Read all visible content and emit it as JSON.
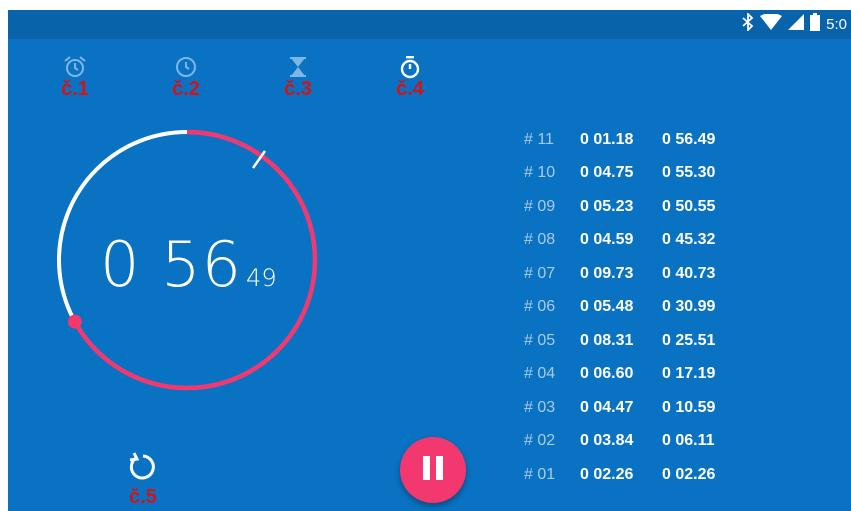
{
  "status_bar": {
    "time": "5:0",
    "icons": [
      "bluetooth-icon",
      "wifi-icon",
      "signal-icon",
      "battery-icon"
    ]
  },
  "tabs": [
    {
      "id": "alarm",
      "icon": "alarm-icon",
      "number": "č.1"
    },
    {
      "id": "clock",
      "icon": "clock-icon",
      "number": "č.2"
    },
    {
      "id": "timer",
      "icon": "hourglass-icon",
      "number": "č.3"
    },
    {
      "id": "stopwatch",
      "icon": "stopwatch-icon",
      "number": "č.4"
    }
  ],
  "stopwatch": {
    "seconds_display": "0 56",
    "hundredths_display": "49",
    "lap_progress_fraction": 0.67
  },
  "laps": [
    {
      "num": "# 11",
      "split": "0 01.18",
      "total": "0 56.49"
    },
    {
      "num": "# 10",
      "split": "0 04.75",
      "total": "0 55.30"
    },
    {
      "num": "# 09",
      "split": "0 05.23",
      "total": "0 50.55"
    },
    {
      "num": "# 08",
      "split": "0 04.59",
      "total": "0 45.32"
    },
    {
      "num": "# 07",
      "split": "0 09.73",
      "total": "0 40.73"
    },
    {
      "num": "# 06",
      "split": "0 05.48",
      "total": "0 30.99"
    },
    {
      "num": "# 05",
      "split": "0 08.31",
      "total": "0 25.51"
    },
    {
      "num": "# 04",
      "split": "0 06.60",
      "total": "0 17.19"
    },
    {
      "num": "# 03",
      "split": "0 04.47",
      "total": "0 10.59"
    },
    {
      "num": "# 02",
      "split": "0 03.84",
      "total": "0 06.11"
    },
    {
      "num": "# 01",
      "split": "0 02.26",
      "total": "0 02.26"
    }
  ],
  "reset": {
    "icon": "reset-icon",
    "number": "č.5"
  },
  "fab": {
    "icon": "pause-icon"
  },
  "colors": {
    "background": "#0a72c2",
    "status_bar": "#0863aa",
    "accent": "#f2386f",
    "annotation": "#d0141a"
  }
}
